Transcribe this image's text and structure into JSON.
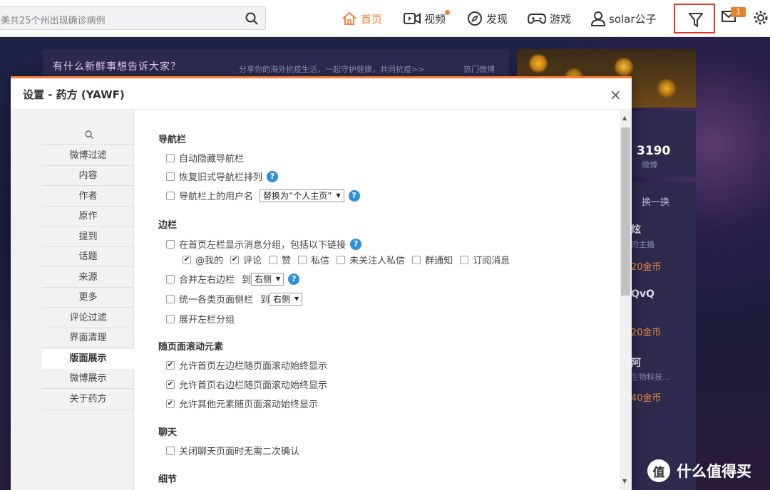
{
  "topbar": {
    "search_text": "美共25个州出现确诊病例",
    "nav": [
      {
        "label": "首页",
        "icon": "home-icon"
      },
      {
        "label": "视频",
        "icon": "video-icon"
      },
      {
        "label": "发现",
        "icon": "compass-icon"
      },
      {
        "label": "游戏",
        "icon": "gamepad-icon"
      },
      {
        "label": "solar公子",
        "icon": "user-icon"
      }
    ],
    "message_badge": "1"
  },
  "background": {
    "post_prompt": "有什么新鲜事想告诉大家？",
    "post_hint": "分享你的海外抗疫生活，一起守护健康，共同抗疫>>",
    "hot": "热门微博",
    "follow_count": "3190",
    "follow_label": "微博",
    "refresh": "换一换",
    "recs": [
      {
        "name": "炫",
        "desc": "的主播",
        "coins": "20金币"
      },
      {
        "name": "QvQ",
        "desc": "",
        "coins": "20金币"
      },
      {
        "name": "阿",
        "desc": "生物科技...",
        "coins": "40金币"
      }
    ],
    "watermark": "什么值得买",
    "watermark_glyph": "值"
  },
  "dialog": {
    "title": "设置 - 药方 (YAWF)",
    "close": "×",
    "sidebar": [
      "微博过滤",
      "内容",
      "作者",
      "原作",
      "提到",
      "话题",
      "来源",
      "更多",
      "评论过滤",
      "界面清理",
      "版面展示",
      "微博展示",
      "关于药方"
    ],
    "active_item": "版面展示",
    "sections": {
      "nav": {
        "title": "导航栏",
        "auto_hide": "自动隐藏导航栏",
        "restore": "恢复旧式导航栏排列",
        "username": "导航栏上的用户名",
        "username_select": "替换为“个人主页”"
      },
      "sidebar": {
        "title": "边栏",
        "show_groups": "在首页左栏显示消息分组，包括以下链接",
        "links": [
          {
            "label": "@我的",
            "checked": true
          },
          {
            "label": "评论",
            "checked": true
          },
          {
            "label": "赞",
            "checked": false
          },
          {
            "label": "私信",
            "checked": false
          },
          {
            "label": "未关注人私信",
            "checked": false
          },
          {
            "label": "群通知",
            "checked": false
          },
          {
            "label": "订阅消息",
            "checked": false
          }
        ],
        "merge": "合并左右边栏",
        "to": "到",
        "merge_select": "右侧",
        "unify": "统一各类页面侧栏",
        "unify_select": "右侧",
        "expand": "展开左栏分组"
      },
      "scroll": {
        "title": "随页面滚动元素",
        "left": "允许首页左边栏随页面滚动始终显示",
        "right": "允许首页右边栏随页面滚动始终显示",
        "other": "允许其他元素随页面滚动始终显示"
      },
      "chat": {
        "title": "聊天",
        "no_confirm": "关闭聊天页面时无需二次确认"
      },
      "detail": {
        "title": "细节"
      }
    },
    "help_glyph": "?",
    "check_glyph": "✔"
  },
  "colors": {
    "accent": "#fa7d3c",
    "filter_highlight": "#e2382c",
    "help": "#2f8fd8"
  }
}
